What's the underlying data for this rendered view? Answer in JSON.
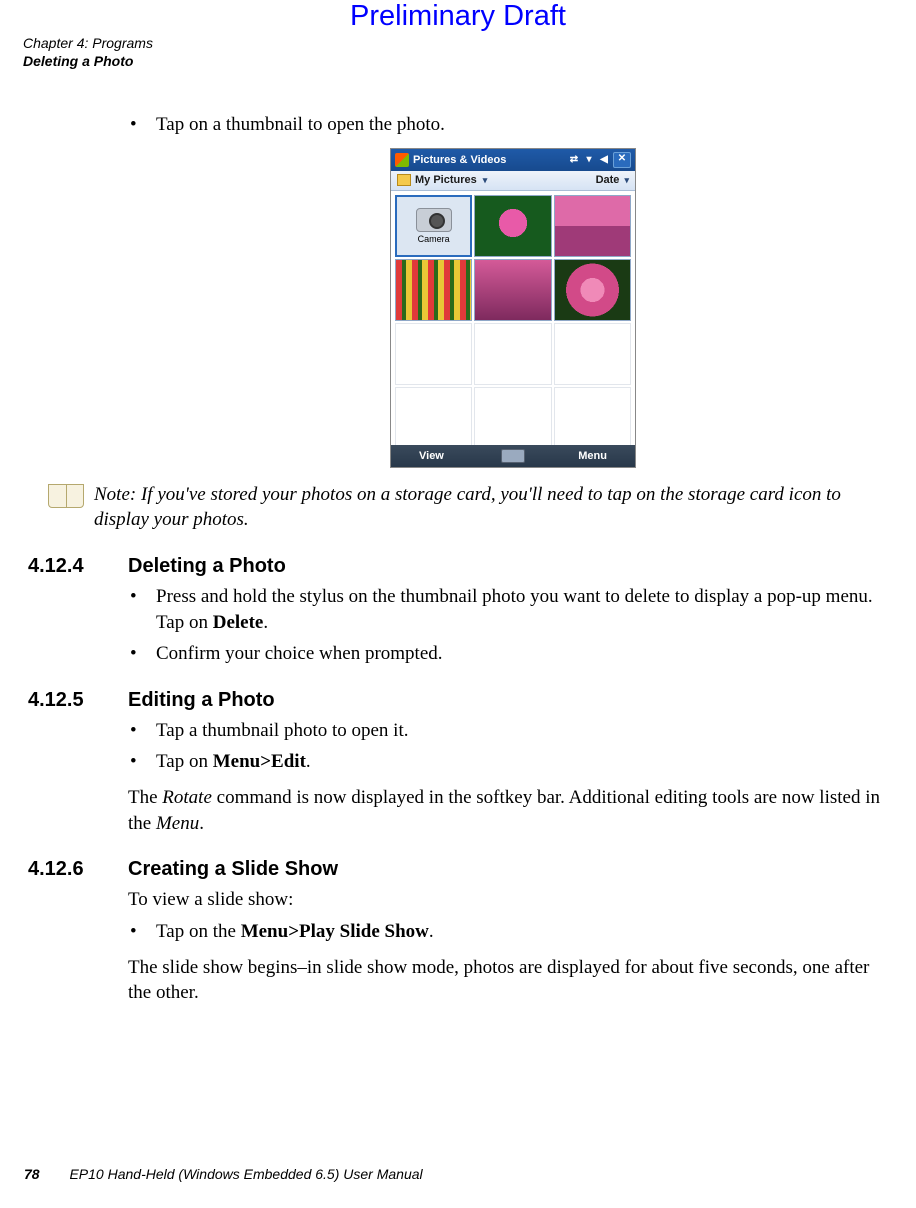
{
  "watermark": "Preliminary Draft",
  "header": {
    "chapter": "Chapter 4: Programs",
    "section": "Deleting a Photo"
  },
  "intro_bullet": "Tap on a thumbnail to open the photo.",
  "screenshot": {
    "titlebar": {
      "app_title": "Pictures & Videos",
      "icons": {
        "start": "start-icon",
        "connectivity": "connectivity-icon",
        "signal": "signal-icon",
        "volume": "volume-icon",
        "close": "close-icon"
      },
      "close_glyph": "✕"
    },
    "toolbar": {
      "folder_label": "My Pictures",
      "sort_label": "Date"
    },
    "thumbnails": {
      "camera_label": "Camera"
    },
    "softkeys": {
      "left": "View",
      "right": "Menu"
    }
  },
  "note": {
    "label": "Note:",
    "text": "If you've stored your photos on a storage card, you'll need to tap on the storage card icon to display your photos."
  },
  "sections": [
    {
      "number": "4.12.4",
      "title": "Deleting a Photo",
      "bullets": [
        {
          "pre": "Press and hold the stylus on the thumbnail photo you want to delete to display a pop-up menu. Tap on ",
          "bold": "Delete",
          "post": "."
        },
        {
          "pre": "Confirm your choice when prompted.",
          "bold": "",
          "post": ""
        }
      ]
    },
    {
      "number": "4.12.5",
      "title": "Editing a Photo",
      "bullets": [
        {
          "pre": "Tap a thumbnail photo to open it.",
          "bold": "",
          "post": ""
        },
        {
          "pre": "Tap on ",
          "bold": "Menu>Edit",
          "post": "."
        }
      ],
      "para_parts": {
        "p1": "The ",
        "em1": "Rotate",
        "p2": " command is now displayed in the softkey bar. Additional editing tools are now listed in the ",
        "em2": "Menu",
        "p3": "."
      }
    },
    {
      "number": "4.12.6",
      "title": "Creating a Slide Show",
      "intro": "To view a slide show:",
      "bullets": [
        {
          "pre": "Tap on the ",
          "bold": "Menu>Play Slide Show",
          "post": "."
        }
      ],
      "para": "The slide show begins–in slide show mode, photos are displayed for about five seconds, one after the other."
    }
  ],
  "footer": {
    "page": "78",
    "doc_title": "EP10 Hand-Held (Windows Embedded 6.5) User Manual"
  }
}
